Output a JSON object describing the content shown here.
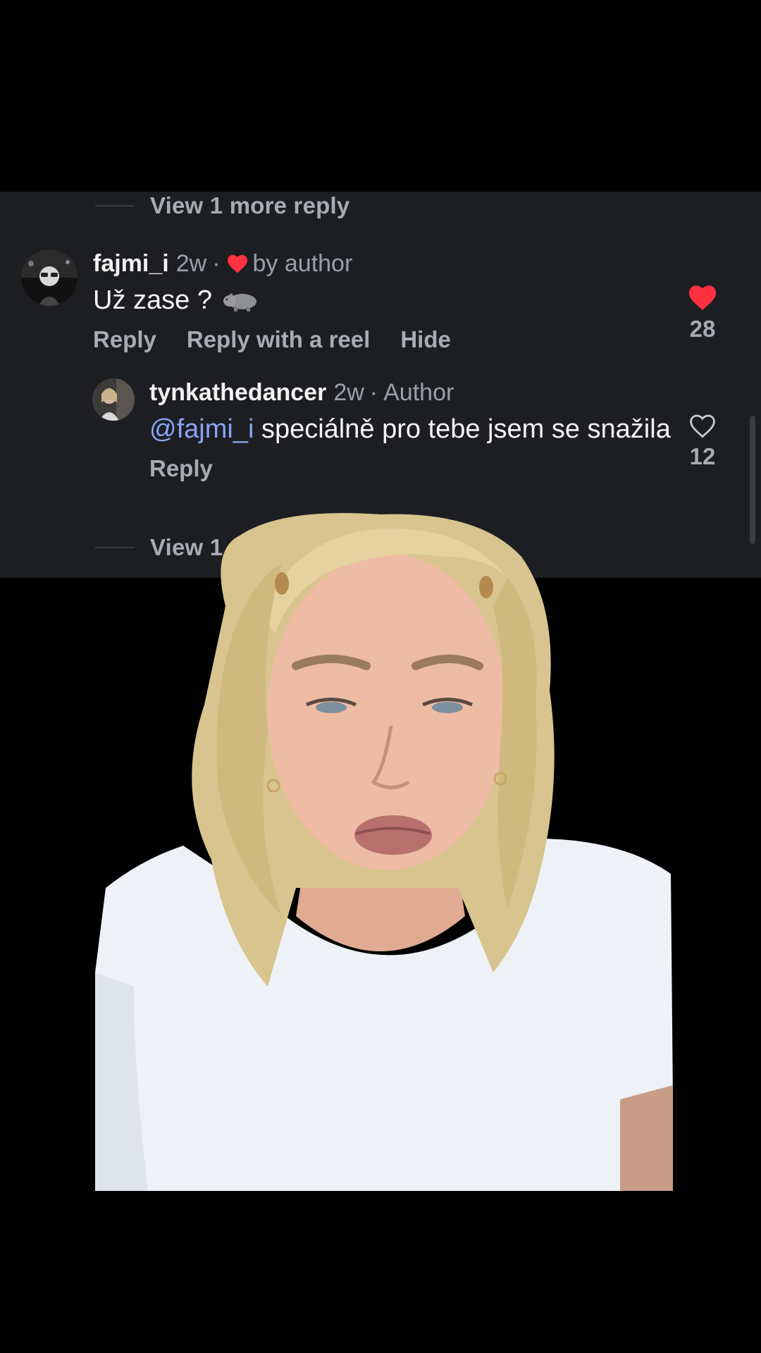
{
  "thread": {
    "view_more_top": "View 1 more reply",
    "view_more_bottom": "View 1 more"
  },
  "comment_1": {
    "username": "fajmi_i",
    "time": "2w",
    "separator": "·",
    "liked_by_author": "by author",
    "text": "Už zase ?",
    "emoji_icon": "hippo-emoji-icon",
    "actions": [
      "Reply",
      "Reply with a reel",
      "Hide"
    ],
    "like_count": "28",
    "liked": true
  },
  "comment_2": {
    "username": "tynkathedancer",
    "time": "2w",
    "separator": "·",
    "badge": "Author",
    "mention": "@fajmi_i",
    "text": "speciálně pro tebe jsem se snažila",
    "actions": [
      "Reply"
    ],
    "like_count": "12",
    "liked": false
  },
  "colors": {
    "panel_bg": "#1c1e22",
    "like_red": "#ff3040",
    "mention_blue": "#8aa2f2",
    "muted_text": "#a8abb2"
  }
}
